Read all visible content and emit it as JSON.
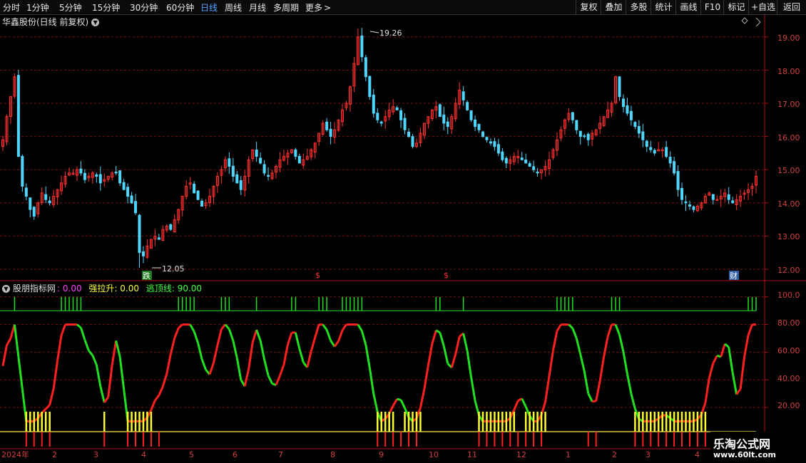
{
  "toolbar": {
    "periods": [
      {
        "label": "分时",
        "active": false
      },
      {
        "label": "1分钟",
        "active": false
      },
      {
        "label": "5分钟",
        "active": false
      },
      {
        "label": "15分钟",
        "active": false
      },
      {
        "label": "30分钟",
        "active": false
      },
      {
        "label": "60分钟",
        "active": false
      },
      {
        "label": "日线",
        "active": true
      },
      {
        "label": "周线",
        "active": false
      },
      {
        "label": "月线",
        "active": false
      },
      {
        "label": "多周期",
        "active": false
      },
      {
        "label": "更多",
        "active": false
      }
    ],
    "more_arrow": ">",
    "right_buttons": [
      "复权",
      "叠加",
      "多股",
      "统计",
      "画线",
      "F10",
      "标记",
      "+自选",
      "返回"
    ]
  },
  "main_chart": {
    "title": "华鑫股份(日线 前复权)",
    "y_ticks": [
      "19.00",
      "18.00",
      "17.00",
      "16.00",
      "15.00",
      "14.00",
      "13.00",
      "12.00"
    ],
    "high_label": "19.26",
    "low_label": "12.05",
    "markers": [
      {
        "text": "跌",
        "color": "#ffffff",
        "bg": "#1f7a1f"
      },
      {
        "text": "$",
        "color": "#ff3030"
      },
      {
        "text": "$",
        "color": "#ff3030"
      },
      {
        "text": "财",
        "color": "#ffffff",
        "bg": "#2f5fa8"
      }
    ]
  },
  "indicator": {
    "name": "股朋指标网",
    "values": [
      {
        "label": "",
        "value": ": 0.00",
        "color": "#ff40ff"
      },
      {
        "label": "强拉升",
        "value": ": 0.00",
        "color": "#ffff40"
      },
      {
        "label": "逃顶线",
        "value": ": 90.00",
        "color": "#40ff40"
      }
    ],
    "y_ticks": [
      "100.0",
      "80.00",
      "60.00",
      "40.00",
      "20.00"
    ]
  },
  "x_axis": {
    "labels": [
      "2024年",
      "2",
      "3",
      "4",
      "5",
      "6",
      "7",
      "8",
      "9",
      "10",
      "11",
      "12",
      "1",
      "2",
      "3",
      "4"
    ]
  },
  "watermark": {
    "line1": "乐淘公式网",
    "line2": "www.60lt.com"
  },
  "colors": {
    "up": "#ff3030",
    "down": "#4fd6ff",
    "grid": "#7a1010",
    "axis": "#b01010",
    "green": "#20e020",
    "yellow": "#ffff30"
  },
  "chart_data": {
    "type": "candlestick",
    "price_range": [
      11.8,
      19.5
    ],
    "high": 19.26,
    "low": 12.05,
    "close_series": [
      15.9,
      16.6,
      17.2,
      17.8,
      15.4,
      14.5,
      14.2,
      13.8,
      13.6,
      14.0,
      14.3,
      14.1,
      14.0,
      14.2,
      14.4,
      14.6,
      14.8,
      14.9,
      14.9,
      15.0,
      14.9,
      14.7,
      14.8,
      14.9,
      14.8,
      14.6,
      14.7,
      14.8,
      14.9,
      14.9,
      14.6,
      14.4,
      14.2,
      14.0,
      13.7,
      12.5,
      12.4,
      12.7,
      12.9,
      13.0,
      12.9,
      13.2,
      13.3,
      13.2,
      13.5,
      13.8,
      14.2,
      14.5,
      14.6,
      14.3,
      14.1,
      13.9,
      14.0,
      14.2,
      14.5,
      14.8,
      15.0,
      15.3,
      15.1,
      14.8,
      14.6,
      14.4,
      14.8,
      15.3,
      15.6,
      15.4,
      15.2,
      14.9,
      14.8,
      14.9,
      15.1,
      15.3,
      15.4,
      15.5,
      15.6,
      15.4,
      15.2,
      15.3,
      15.4,
      15.6,
      15.8,
      16.1,
      16.4,
      16.2,
      16.0,
      16.2,
      16.5,
      16.8,
      17.0,
      17.5,
      18.2,
      19.0,
      18.4,
      17.8,
      17.2,
      16.7,
      16.5,
      16.4,
      16.6,
      16.8,
      16.9,
      16.8,
      16.5,
      16.2,
      16.0,
      15.7,
      15.8,
      16.1,
      16.4,
      16.6,
      16.8,
      16.9,
      16.6,
      16.4,
      16.3,
      16.6,
      17.0,
      17.4,
      17.1,
      16.8,
      16.5,
      16.3,
      16.2,
      16.0,
      15.9,
      15.8,
      15.7,
      15.5,
      15.3,
      15.2,
      15.3,
      15.4,
      15.4,
      15.3,
      15.2,
      15.1,
      15.0,
      14.9,
      15.0,
      15.1,
      15.3,
      15.6,
      15.9,
      16.2,
      16.5,
      16.7,
      16.5,
      16.2,
      16.0,
      16.0,
      15.9,
      16.1,
      16.2,
      16.4,
      16.6,
      16.8,
      17.0,
      17.8,
      17.2,
      16.9,
      16.7,
      16.5,
      16.3,
      16.1,
      15.9,
      15.7,
      15.6,
      15.5,
      15.6,
      15.6,
      15.4,
      15.2,
      14.9,
      14.4,
      14.1,
      14.0,
      13.9,
      13.8,
      13.9,
      14.0,
      14.2,
      14.3,
      14.1,
      14.1,
      14.2,
      14.3,
      14.1,
      14.0,
      14.1,
      14.2,
      14.3,
      14.4,
      14.5,
      14.8
    ]
  }
}
